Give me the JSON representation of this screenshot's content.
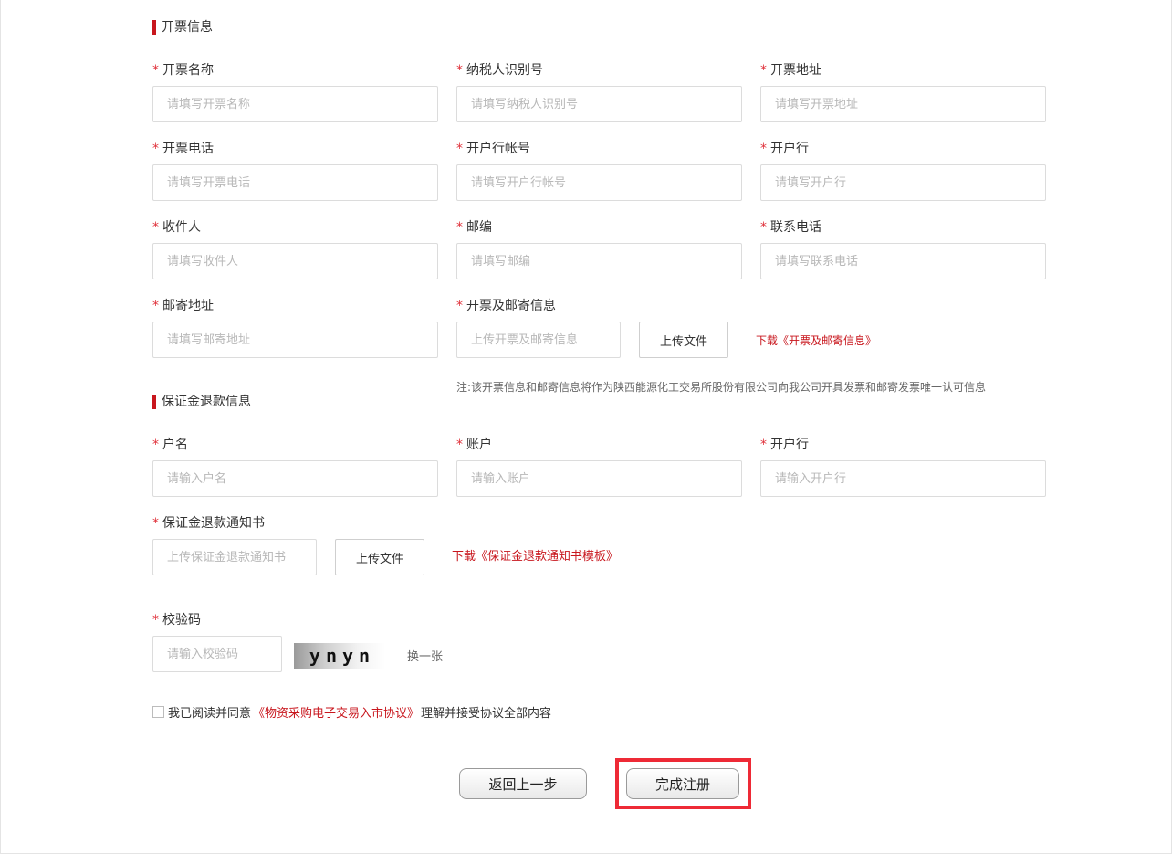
{
  "invoice_section": {
    "title": "开票信息",
    "fields": [
      {
        "label": "开票名称",
        "placeholder": "请填写开票名称"
      },
      {
        "label": "纳税人识别号",
        "placeholder": "请填写纳税人识别号"
      },
      {
        "label": "开票地址",
        "placeholder": "请填写开票地址"
      },
      {
        "label": "开票电话",
        "placeholder": "请填写开票电话"
      },
      {
        "label": "开户行帐号",
        "placeholder": "请填写开户行帐号"
      },
      {
        "label": "开户行",
        "placeholder": "请填写开户行"
      },
      {
        "label": "收件人",
        "placeholder": "请填写收件人"
      },
      {
        "label": "邮编",
        "placeholder": "请填写邮编"
      },
      {
        "label": "联系电话",
        "placeholder": "请填写联系电话"
      },
      {
        "label": "邮寄地址",
        "placeholder": "请填写邮寄地址"
      }
    ],
    "upload": {
      "label": "开票及邮寄信息",
      "placeholder": "上传开票及邮寄信息",
      "button": "上传文件",
      "download_link": "下载《开票及邮寄信息》"
    },
    "note": "注:该开票信息和邮寄信息将作为陕西能源化工交易所股份有限公司向我公司开具发票和邮寄发票唯一认可信息"
  },
  "refund_section": {
    "title": "保证金退款信息",
    "fields": [
      {
        "label": "户名",
        "placeholder": "请输入户名"
      },
      {
        "label": "账户",
        "placeholder": "请输入账户"
      },
      {
        "label": "开户行",
        "placeholder": "请输入开户行"
      }
    ],
    "upload": {
      "label": "保证金退款通知书",
      "placeholder": "上传保证金退款通知书",
      "button": "上传文件",
      "download_link": "下载《保证金退款通知书模板》"
    }
  },
  "verification": {
    "label": "校验码",
    "placeholder": "请输入校验码",
    "captcha_text": "ynyn",
    "refresh_label": "换一张"
  },
  "agreement": {
    "prefix": "我已阅读并同意",
    "link": "《物资采购电子交易入市协议》",
    "suffix": "理解并接受协议全部内容"
  },
  "buttons": {
    "back": "返回上一步",
    "submit": "完成注册"
  },
  "colors": {
    "accent": "#c8161d",
    "required": "#e0303a",
    "highlight": "#ee2a36"
  }
}
